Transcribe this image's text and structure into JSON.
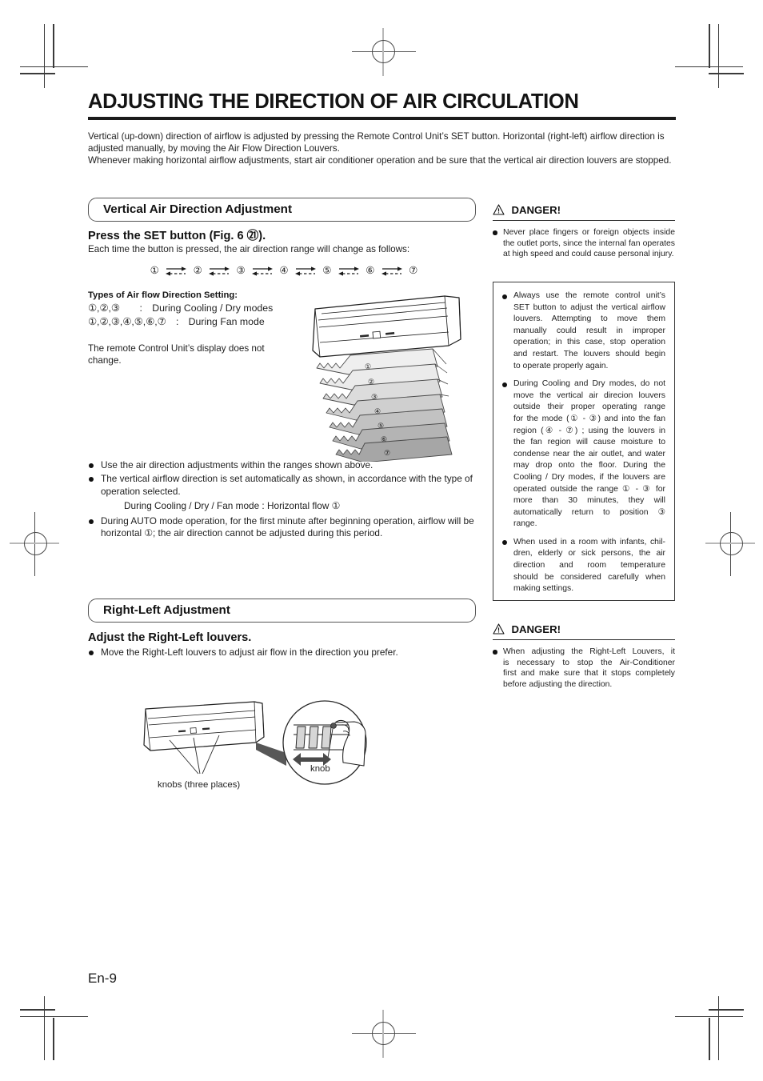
{
  "document": {
    "title": "ADJUSTING THE DIRECTION OF AIR CIRCULATION",
    "page_number": "En-9",
    "intro": "Vertical (up-down) direction of airflow is adjusted by pressing the Remote Control Unit’s SET button. Horizontal (right-left) airflow direction is adjusted manually, by moving the Air Flow Direction Louvers.\nWhenever making horizontal airflow adjustments, start air conditioner operation and be sure that the vertical air direction louvers are stopped."
  },
  "vertical_section": {
    "header": "Vertical Air Direction Adjustment",
    "subhead": "Press the SET button (Fig. 6 ㉑).",
    "instruction": "Each time the button is pressed, the air direction range will change as follows:",
    "sequence": [
      "①",
      "②",
      "③",
      "④",
      "⑤",
      "⑥",
      "⑦"
    ],
    "types_heading": "Types of Air flow Direction Setting:",
    "types_rows": [
      "①,②,③  : During Cooling / Dry modes",
      "①,②,③,④,⑤,⑥,⑦ : During Fan mode"
    ],
    "display_note": "The remote Control Unit’s display does not change.",
    "diagram_labels": [
      "①",
      "②",
      "③",
      "④",
      "⑤",
      "⑥",
      "⑦"
    ],
    "bullets": [
      "Use the air direction adjustments within the ranges shown above.",
      "The vertical airflow direction is set automatically as shown, in accordance with the type of operation selected.",
      "During Cooling / Dry / Fan mode :  Horizontal flow ①",
      "During AUTO mode operation, for the first minute after beginning operation, airflow will be horizontal ①; the air direction cannot be adjusted during this period."
    ]
  },
  "rightleft_section": {
    "header": "Right-Left Adjustment",
    "subhead": "Adjust the Right-Left louvers.",
    "bullet": "Move the Right-Left louvers to adjust air flow in the direction you prefer.",
    "caption_knobs": "knobs (three places)",
    "caption_knob": "knob"
  },
  "danger_top": {
    "icon": "warning-triangle-icon",
    "label": "DANGER!",
    "bullet": "Never place fingers or foreign objects inside the outlet ports, since the internal fan operates at high speed and could cause personal injury."
  },
  "caution_box": {
    "bullets": [
      {
        "lines": [
          "Always use the remote control unit’s",
          "SET button to adjust the vertical airflow",
          "louvers. Attempting to move them",
          "manually could result in improper",
          "operation; in this case, stop operation",
          "and restart. The louvers should begin"
        ],
        "last": "to operate properly again."
      },
      {
        "lines": [
          "During Cooling and Dry modes, do not",
          "move the vertical air direcion louvers",
          "outside their proper operating range",
          "for the mode (① - ③) and into the fan",
          "region (④ - ⑦) ; using the louvers in",
          "the fan region will cause moisture to",
          "condense near the air outlet, and water",
          "may drop onto the floor. During the",
          "Cooling / Dry modes, if the louvers are",
          "operated outside the range ① - ③ for",
          "more than 30 minutes, they will",
          "automatically return to position ③"
        ],
        "last": "range."
      },
      {
        "lines": [
          "When used in a room with infants, chil-",
          "dren, elderly or sick persons, the air",
          "direction and room temperature",
          "should be considered carefully when"
        ],
        "last": "making settings."
      }
    ]
  },
  "danger_bottom": {
    "icon": "warning-triangle-icon",
    "label": "DANGER!",
    "lines": [
      "When adjusting the Right-Left Louvers, it",
      "is necessary to stop the Air-Conditioner",
      "first and make sure that it stops completely"
    ],
    "last": "before adjusting the direction."
  }
}
